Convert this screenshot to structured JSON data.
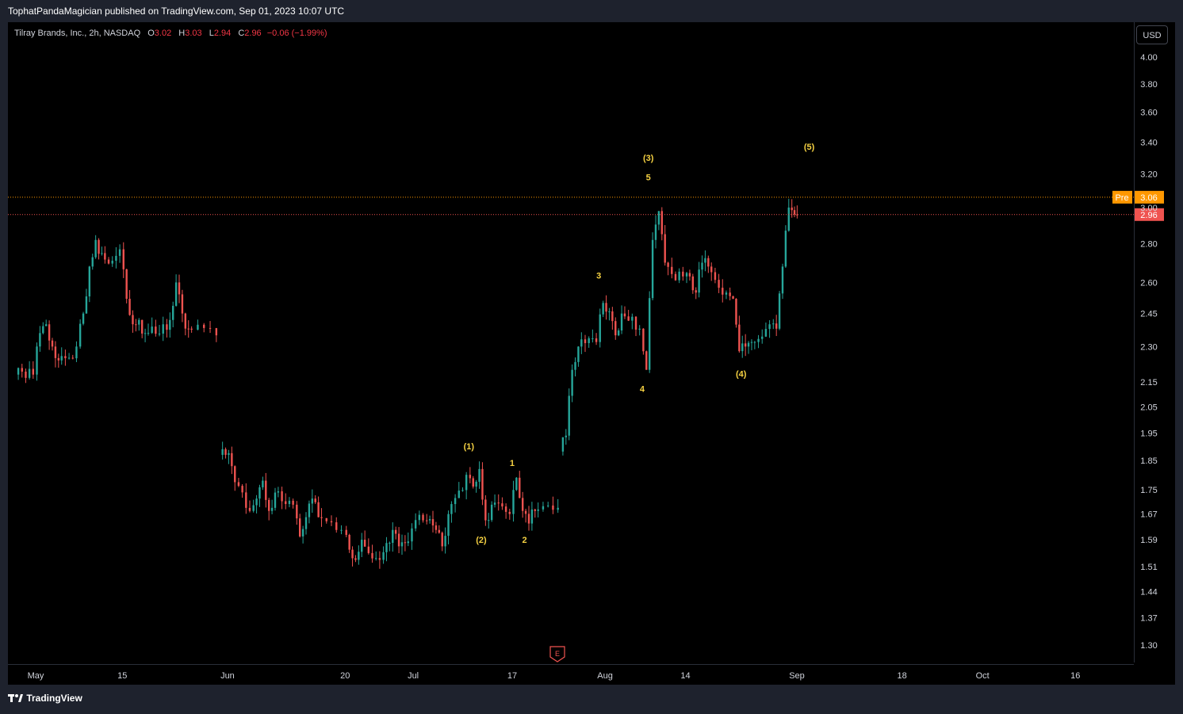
{
  "header": {
    "publisher_line": "TophatPandaMagician published on TradingView.com, Sep 01, 2023 10:07 UTC"
  },
  "legend": {
    "symbol": "Tilray Brands, Inc., 2h, NASDAQ",
    "open_label": "O",
    "open": "3.02",
    "high_label": "H",
    "high": "3.03",
    "low_label": "L",
    "low": "2.94",
    "close_label": "C",
    "close": "2.96",
    "change": "−0.06 (−1.99%)"
  },
  "currency_button": "USD",
  "footer": {
    "brand": "TradingView"
  },
  "earnings_marker": "E",
  "colors": {
    "up": "#26a69a",
    "down": "#ef5350",
    "accent": "#f5d142",
    "pre": "#ff9800",
    "background": "#000000"
  },
  "chart_data": {
    "type": "candlestick",
    "symbol": "TLRY",
    "interval": "2h",
    "y_scale": "log",
    "ylim": [
      1.27,
      4.1
    ],
    "y_ticks": [
      "4.00",
      "3.80",
      "3.60",
      "3.40",
      "3.20",
      "3.06",
      "3.00",
      "2.96",
      "2.80",
      "2.60",
      "2.45",
      "2.30",
      "2.15",
      "2.05",
      "1.95",
      "1.85",
      "1.75",
      "1.67",
      "1.59",
      "1.51",
      "1.44",
      "1.37",
      "1.30"
    ],
    "y_tick_values": [
      4.0,
      3.8,
      3.6,
      3.4,
      3.2,
      3.06,
      3.0,
      2.96,
      2.8,
      2.6,
      2.45,
      2.3,
      2.15,
      2.05,
      1.95,
      1.85,
      1.75,
      1.67,
      1.59,
      1.51,
      1.44,
      1.37,
      1.3
    ],
    "x_ticks": [
      {
        "label": "May",
        "date": "2023-05-01"
      },
      {
        "label": "15",
        "date": "2023-05-15"
      },
      {
        "label": "Jun",
        "date": "2023-06-01"
      },
      {
        "label": "20",
        "date": "2023-06-20"
      },
      {
        "label": "Jul",
        "date": "2023-07-01"
      },
      {
        "label": "17",
        "date": "2023-07-17"
      },
      {
        "label": "Aug",
        "date": "2023-08-01"
      },
      {
        "label": "14",
        "date": "2023-08-14"
      },
      {
        "label": "Sep",
        "date": "2023-09-01"
      },
      {
        "label": "18",
        "date": "2023-09-18"
      },
      {
        "label": "Oct",
        "date": "2023-10-01"
      },
      {
        "label": "16",
        "date": "2023-10-16"
      }
    ],
    "price_lines": [
      {
        "label": "Pre",
        "value": 3.06,
        "color": "#ff9800"
      },
      {
        "label": "",
        "value": 2.96,
        "color": "#ef5350"
      }
    ],
    "series": [
      {
        "name": "",
        "closes": [
          {
            "date": "2023-04-28",
            "close": 2.18
          },
          {
            "date": "2023-05-01",
            "close": 2.36
          },
          {
            "date": "2023-05-02",
            "close": 2.4
          },
          {
            "date": "2023-05-03",
            "close": 2.3
          },
          {
            "date": "2023-05-04",
            "close": 2.24
          },
          {
            "date": "2023-05-05",
            "close": 2.3
          },
          {
            "date": "2023-05-08",
            "close": 2.45
          },
          {
            "date": "2023-05-09",
            "close": 2.68
          },
          {
            "date": "2023-05-10",
            "close": 2.82
          },
          {
            "date": "2023-05-11",
            "close": 2.75
          },
          {
            "date": "2023-05-12",
            "close": 2.77
          },
          {
            "date": "2023-05-15",
            "close": 2.52
          },
          {
            "date": "2023-05-16",
            "close": 2.4
          },
          {
            "date": "2023-05-17",
            "close": 2.42
          },
          {
            "date": "2023-05-18",
            "close": 2.36
          },
          {
            "date": "2023-05-19",
            "close": 2.4
          },
          {
            "date": "2023-05-22",
            "close": 2.42
          },
          {
            "date": "2023-05-23",
            "close": 2.6
          },
          {
            "date": "2023-05-24",
            "close": 2.45
          },
          {
            "date": "2023-05-25",
            "close": 2.38
          },
          {
            "date": "2023-05-26",
            "close": 2.35
          },
          {
            "date": "2023-05-31",
            "close": 1.87
          },
          {
            "date": "2023-06-01",
            "close": 1.83
          },
          {
            "date": "2023-06-02",
            "close": 1.68
          },
          {
            "date": "2023-06-05",
            "close": 1.72
          },
          {
            "date": "2023-06-06",
            "close": 1.78
          },
          {
            "date": "2023-06-07",
            "close": 1.68
          },
          {
            "date": "2023-06-08",
            "close": 1.74
          },
          {
            "date": "2023-06-09",
            "close": 1.7
          },
          {
            "date": "2023-06-12",
            "close": 1.6
          },
          {
            "date": "2023-06-13",
            "close": 1.66
          },
          {
            "date": "2023-06-14",
            "close": 1.72
          },
          {
            "date": "2023-06-15",
            "close": 1.66
          },
          {
            "date": "2023-06-16",
            "close": 1.62
          },
          {
            "date": "2023-06-20",
            "close": 1.56
          },
          {
            "date": "2023-06-21",
            "close": 1.53
          },
          {
            "date": "2023-06-22",
            "close": 1.59
          },
          {
            "date": "2023-06-23",
            "close": 1.53
          },
          {
            "date": "2023-06-26",
            "close": 1.58
          },
          {
            "date": "2023-06-27",
            "close": 1.62
          },
          {
            "date": "2023-06-28",
            "close": 1.57
          },
          {
            "date": "2023-06-29",
            "close": 1.58
          },
          {
            "date": "2023-06-30",
            "close": 1.65
          },
          {
            "date": "2023-07-03",
            "close": 1.62
          },
          {
            "date": "2023-07-05",
            "close": 1.57
          },
          {
            "date": "2023-07-06",
            "close": 1.67
          },
          {
            "date": "2023-07-07",
            "close": 1.8
          },
          {
            "date": "2023-07-10",
            "close": 1.76
          },
          {
            "date": "2023-07-11",
            "close": 1.82
          },
          {
            "date": "2023-07-12",
            "close": 1.65
          },
          {
            "date": "2023-07-13",
            "close": 1.7
          },
          {
            "date": "2023-07-14",
            "close": 1.67
          },
          {
            "date": "2023-07-17",
            "close": 1.79
          },
          {
            "date": "2023-07-18",
            "close": 1.68
          },
          {
            "date": "2023-07-19",
            "close": 1.64
          },
          {
            "date": "2023-07-20",
            "close": 1.68
          },
          {
            "date": "2023-07-21",
            "close": 1.69
          },
          {
            "date": "2023-07-25",
            "close": 1.94
          },
          {
            "date": "2023-07-26",
            "close": 2.2
          },
          {
            "date": "2023-07-27",
            "close": 2.3
          },
          {
            "date": "2023-07-28",
            "close": 2.32
          },
          {
            "date": "2023-07-31",
            "close": 2.5
          },
          {
            "date": "2023-08-01",
            "close": 2.46
          },
          {
            "date": "2023-08-02",
            "close": 2.35
          },
          {
            "date": "2023-08-03",
            "close": 2.45
          },
          {
            "date": "2023-08-04",
            "close": 2.38
          },
          {
            "date": "2023-08-07",
            "close": 2.2
          },
          {
            "date": "2023-08-08",
            "close": 2.82
          },
          {
            "date": "2023-08-09",
            "close": 2.98
          },
          {
            "date": "2023-08-10",
            "close": 2.7
          },
          {
            "date": "2023-08-11",
            "close": 2.63
          },
          {
            "date": "2023-08-14",
            "close": 2.63
          },
          {
            "date": "2023-08-15",
            "close": 2.55
          },
          {
            "date": "2023-08-16",
            "close": 2.7
          },
          {
            "date": "2023-08-17",
            "close": 2.68
          },
          {
            "date": "2023-08-18",
            "close": 2.55
          },
          {
            "date": "2023-08-21",
            "close": 2.52
          },
          {
            "date": "2023-08-22",
            "close": 2.28
          },
          {
            "date": "2023-08-23",
            "close": 2.3
          },
          {
            "date": "2023-08-24",
            "close": 2.32
          },
          {
            "date": "2023-08-25",
            "close": 2.4
          },
          {
            "date": "2023-08-28",
            "close": 2.38
          },
          {
            "date": "2023-08-29",
            "close": 2.68
          },
          {
            "date": "2023-08-30",
            "close": 3.0
          },
          {
            "date": "2023-08-31",
            "close": 2.96
          }
        ]
      }
    ],
    "annotations": [
      {
        "text": "(1)",
        "date": "2023-07-10",
        "price": 1.89
      },
      {
        "text": "(2)",
        "date": "2023-07-12",
        "price": 1.58
      },
      {
        "text": "1",
        "date": "2023-07-17",
        "price": 1.83
      },
      {
        "text": "2",
        "date": "2023-07-19",
        "price": 1.58
      },
      {
        "text": "3",
        "date": "2023-07-31",
        "price": 2.62
      },
      {
        "text": "4",
        "date": "2023-08-07",
        "price": 2.11
      },
      {
        "text": "(3)",
        "date": "2023-08-08",
        "price": 3.28
      },
      {
        "text": "5",
        "date": "2023-08-08",
        "price": 3.16
      },
      {
        "text": "(4)",
        "date": "2023-08-23",
        "price": 2.17
      },
      {
        "text": "(5)",
        "date": "2023-09-03",
        "price": 3.35
      }
    ]
  }
}
